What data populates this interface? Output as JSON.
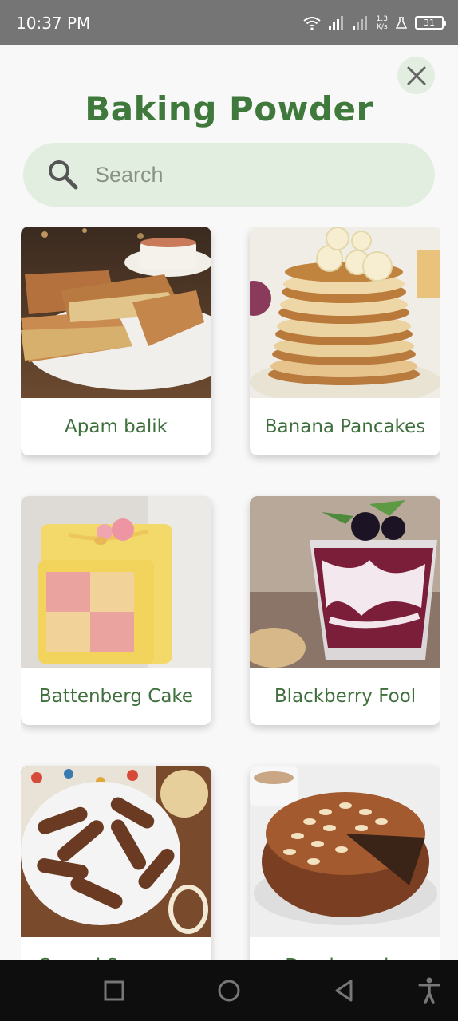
{
  "status_bar": {
    "time": "10:37 PM",
    "net_speed_value": "1.3",
    "net_speed_unit": "K/s",
    "battery": "31"
  },
  "header": {
    "title": "Baking Powder",
    "close_icon": "close-icon"
  },
  "search": {
    "placeholder": "Search",
    "value": ""
  },
  "recipes": [
    {
      "name": "Apam balik"
    },
    {
      "name": "Banana Pancakes"
    },
    {
      "name": "Battenberg Cake"
    },
    {
      "name": "Blackberry Fool"
    },
    {
      "name": "Cevapi Sausages"
    },
    {
      "name": "Dundee cake"
    }
  ],
  "colors": {
    "accent": "#3f7a3c",
    "search_bg": "#e2eee0",
    "status_bar": "#757575",
    "nav_bar": "#0e0e0e"
  }
}
